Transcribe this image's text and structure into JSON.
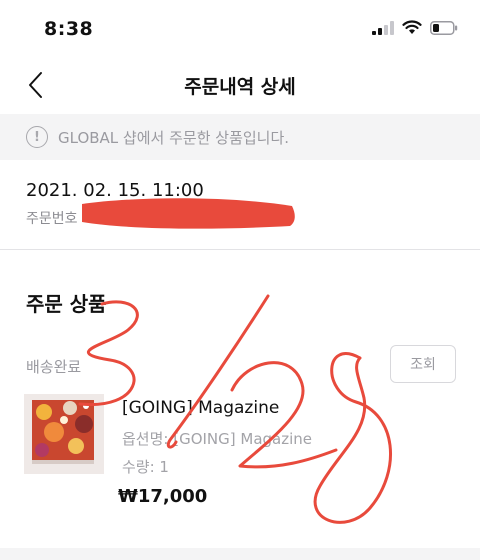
{
  "status_bar": {
    "time": "8:38"
  },
  "header": {
    "title": "주문내역 상세"
  },
  "notice": {
    "icon_glyph": "!",
    "text": "GLOBAL 샵에서 주문한 상품입니다."
  },
  "order": {
    "date": "2021. 02. 15. 11:00",
    "number_label": "주문번호"
  },
  "section": {
    "title": "주문 상품"
  },
  "item": {
    "status": "배송완료",
    "inquiry_label": "조회",
    "name": "[GOING] Magazine",
    "option": "옵션명: [GOING] Magazine",
    "quantity": "수량: 1",
    "price": "₩17,000"
  },
  "annotation": {
    "color": "#e84a3c",
    "handwritten_text": "3/28"
  }
}
